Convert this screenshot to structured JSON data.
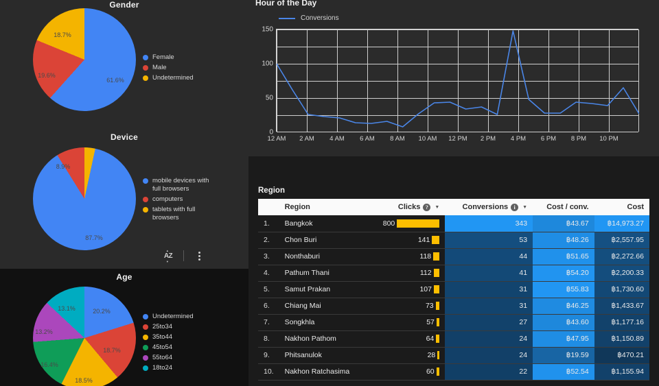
{
  "gender_chart": {
    "title": "Gender",
    "labels": [
      "61.6%",
      "19.6%",
      "18.7%"
    ],
    "legend": [
      "Female",
      "Male",
      "Undetermined"
    ]
  },
  "device_chart": {
    "title": "Device",
    "labels": [
      "87.7%",
      "8.9%"
    ],
    "legend": [
      "mobile devices with full browsers",
      "computers",
      "tablets with full browsers"
    ]
  },
  "age_chart": {
    "title": "Age",
    "labels": [
      "20.2%",
      "18.7%",
      "18.5%",
      "16.4%",
      "13.2%",
      "13.1%"
    ],
    "legend": [
      "Undetermined",
      "25to34",
      "35to44",
      "45to54",
      "55to64",
      "18to24"
    ]
  },
  "tools": {
    "sort_label": "AZ"
  },
  "line_chart": {
    "title": "Hour of the Day",
    "legend": "Conversions",
    "yticks": [
      "150",
      "100",
      "50",
      "0"
    ],
    "xticks": [
      "12 AM",
      "2 AM",
      "4 AM",
      "6 AM",
      "8 AM",
      "10 AM",
      "12 PM",
      "2 PM",
      "4 PM",
      "6 PM",
      "8 PM",
      "10 PM"
    ]
  },
  "table": {
    "title": "Region",
    "headers": {
      "index": "",
      "region": "Region",
      "clicks": "Clicks",
      "conversions": "Conversions",
      "cost_conv": "Cost / conv.",
      "cost": "Cost"
    },
    "rows": [
      {
        "idx": "1.",
        "region": "Bangkok",
        "clicks": "800",
        "conversions": "343",
        "cost_conv": "฿43.67",
        "cost": "฿14,973.27"
      },
      {
        "idx": "2.",
        "region": "Chon Buri",
        "clicks": "141",
        "conversions": "53",
        "cost_conv": "฿48.26",
        "cost": "฿2,557.95"
      },
      {
        "idx": "3.",
        "region": "Nonthaburi",
        "clicks": "118",
        "conversions": "44",
        "cost_conv": "฿51.65",
        "cost": "฿2,272.66"
      },
      {
        "idx": "4.",
        "region": "Pathum Thani",
        "clicks": "112",
        "conversions": "41",
        "cost_conv": "฿54.20",
        "cost": "฿2,200.33"
      },
      {
        "idx": "5.",
        "region": "Samut Prakan",
        "clicks": "107",
        "conversions": "31",
        "cost_conv": "฿55.83",
        "cost": "฿1,730.60"
      },
      {
        "idx": "6.",
        "region": "Chiang Mai",
        "clicks": "73",
        "conversions": "31",
        "cost_conv": "฿46.25",
        "cost": "฿1,433.67"
      },
      {
        "idx": "7.",
        "region": "Songkhla",
        "clicks": "57",
        "conversions": "27",
        "cost_conv": "฿43.60",
        "cost": "฿1,177.16"
      },
      {
        "idx": "8.",
        "region": "Nakhon Pathom",
        "clicks": "64",
        "conversions": "24",
        "cost_conv": "฿47.95",
        "cost": "฿1,150.89"
      },
      {
        "idx": "9.",
        "region": "Phitsanulok",
        "clicks": "28",
        "conversions": "24",
        "cost_conv": "฿19.59",
        "cost": "฿470.21"
      },
      {
        "idx": "10.",
        "region": "Nakhon Ratchasima",
        "clicks": "60",
        "conversions": "22",
        "cost_conv": "฿52.54",
        "cost": "฿1,155.94"
      }
    ]
  },
  "colors": {
    "blue": "#4285f4",
    "red": "#db4437",
    "yellow": "#f4b400",
    "green": "#0f9d58",
    "purple": "#ab47bc",
    "teal": "#00acc1",
    "line": "#4a86e8",
    "bar": "#fdbe00",
    "heat_high": "#2196f3"
  },
  "chart_data": [
    {
      "type": "pie",
      "title": "Gender",
      "categories": [
        "Female",
        "Male",
        "Undetermined"
      ],
      "values": [
        61.6,
        19.6,
        18.7
      ],
      "unit": "%",
      "colors": [
        "#4285f4",
        "#db4437",
        "#f4b400"
      ],
      "legend_position": "right"
    },
    {
      "type": "pie",
      "title": "Device",
      "categories": [
        "mobile devices with full browsers",
        "computers",
        "tablets with full browsers"
      ],
      "values": [
        87.7,
        8.9,
        3.4
      ],
      "unit": "%",
      "colors": [
        "#4285f4",
        "#db4437",
        "#f4b400"
      ],
      "legend_position": "right",
      "note": "only 87.7% and 8.9% labels are rendered on slices"
    },
    {
      "type": "pie",
      "title": "Age",
      "categories": [
        "Undetermined",
        "25to34",
        "35to44",
        "45to54",
        "55to64",
        "18to24"
      ],
      "values": [
        20.2,
        18.7,
        18.5,
        16.4,
        13.2,
        13.1
      ],
      "unit": "%",
      "colors": [
        "#4285f4",
        "#db4437",
        "#f4b400",
        "#0f9d58",
        "#ab47bc",
        "#00acc1"
      ],
      "legend_position": "right"
    },
    {
      "type": "line",
      "title": "Hour of the Day",
      "series": [
        {
          "name": "Conversions",
          "values": [
            100,
            62,
            26,
            23,
            21,
            14,
            13,
            16,
            8,
            27,
            43,
            44,
            34,
            37,
            26,
            148,
            48,
            28,
            28,
            44,
            42,
            39,
            65,
            27
          ]
        }
      ],
      "x": [
        "12 AM",
        "1 AM",
        "2 AM",
        "3 AM",
        "4 AM",
        "5 AM",
        "6 AM",
        "7 AM",
        "8 AM",
        "9 AM",
        "10 AM",
        "11 AM",
        "12 PM",
        "1 PM",
        "2 PM",
        "3 PM",
        "4 PM",
        "5 PM",
        "6 PM",
        "7 PM",
        "8 PM",
        "9 PM",
        "10 PM",
        "11 PM"
      ],
      "xtick_labels": [
        "12 AM",
        "2 AM",
        "4 AM",
        "6 AM",
        "8 AM",
        "10 AM",
        "12 PM",
        "2 PM",
        "4 PM",
        "6 PM",
        "8 PM",
        "10 PM"
      ],
      "ylim": [
        0,
        150
      ],
      "yticks": [
        0,
        50,
        100,
        150
      ],
      "xlabel": "",
      "ylabel": "",
      "grid": true,
      "legend_position": "top-left"
    },
    {
      "type": "table",
      "title": "Region",
      "columns": [
        "",
        "Region",
        "Clicks",
        "Conversions",
        "Cost / conv.",
        "Cost"
      ],
      "rows": [
        [
          "1.",
          "Bangkok",
          800,
          343,
          43.67,
          14973.27
        ],
        [
          "2.",
          "Chon Buri",
          141,
          53,
          48.26,
          2557.95
        ],
        [
          "3.",
          "Nonthaburi",
          118,
          44,
          51.65,
          2272.66
        ],
        [
          "4.",
          "Pathum Thani",
          112,
          41,
          54.2,
          2200.33
        ],
        [
          "5.",
          "Samut Prakan",
          107,
          31,
          55.83,
          1730.6
        ],
        [
          "6.",
          "Chiang Mai",
          73,
          31,
          46.25,
          1433.67
        ],
        [
          "7.",
          "Songkhla",
          57,
          27,
          43.6,
          1177.16
        ],
        [
          "8.",
          "Nakhon Pathom",
          64,
          24,
          47.95,
          1150.89
        ],
        [
          "9.",
          "Phitsanulok",
          28,
          24,
          19.59,
          470.21
        ],
        [
          "10.",
          "Nakhon Ratchasima",
          60,
          22,
          52.54,
          1155.94
        ]
      ],
      "currency": "฿"
    }
  ]
}
